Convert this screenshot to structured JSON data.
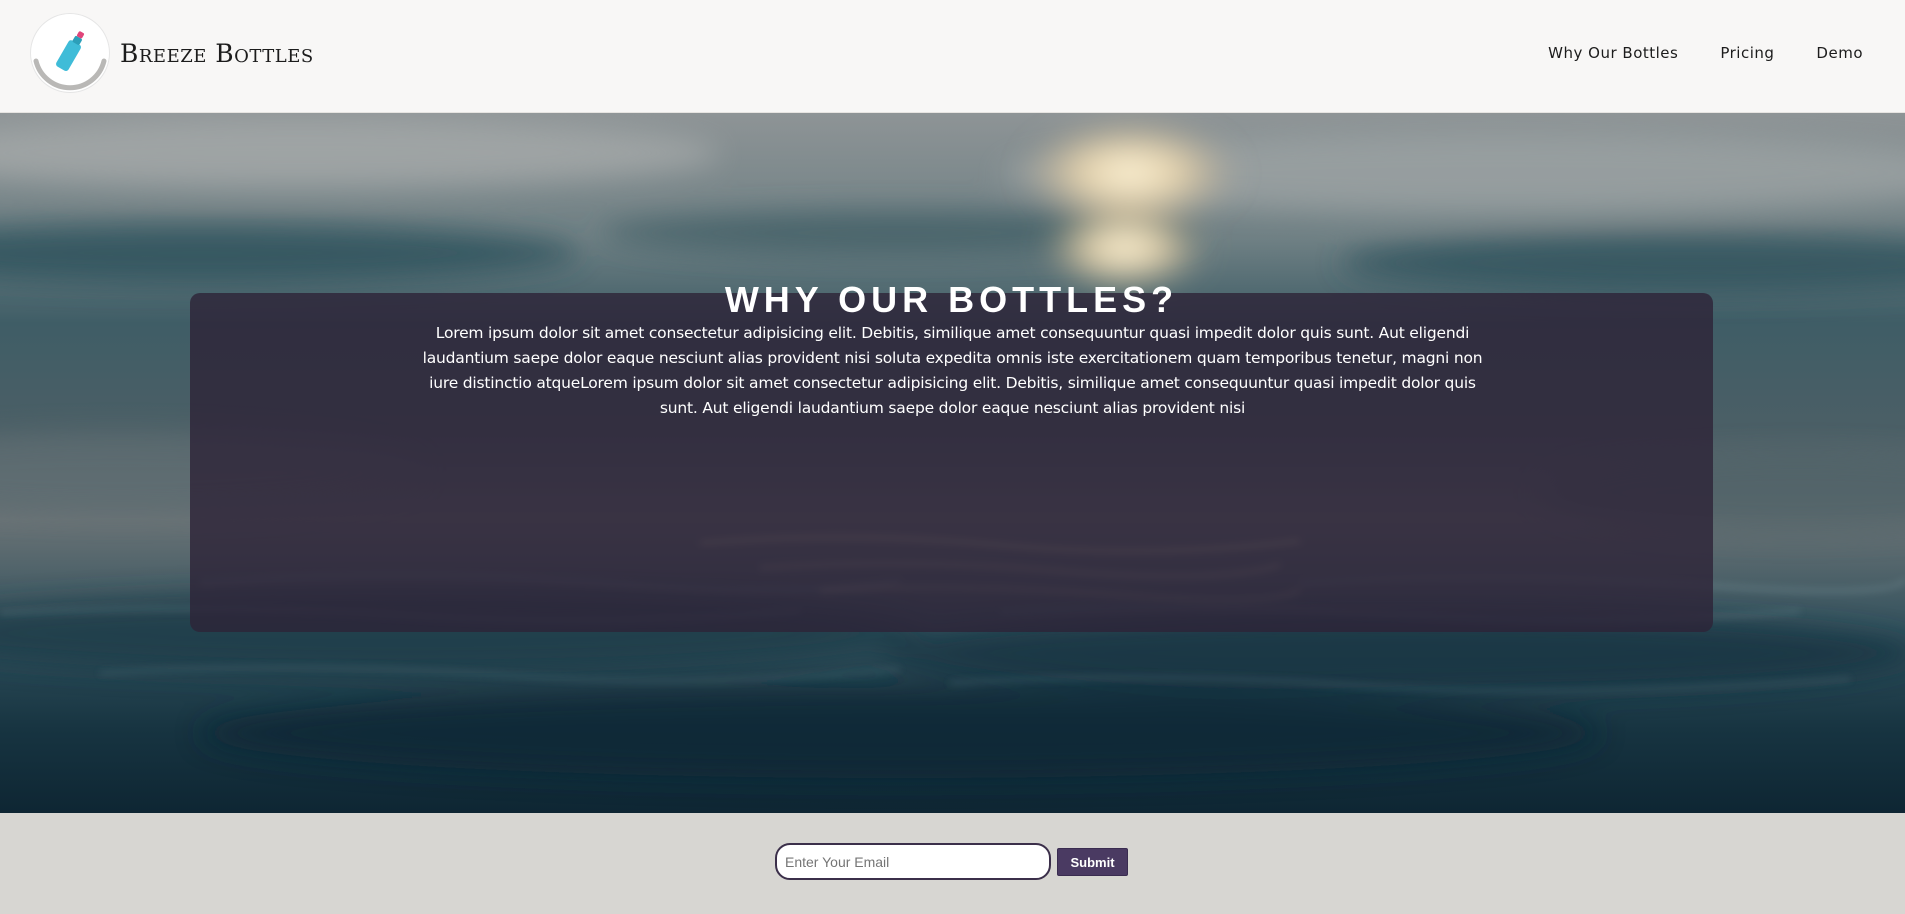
{
  "header": {
    "brand": "Breeze Bottles",
    "nav": [
      {
        "label": "Why Our Bottles"
      },
      {
        "label": "Pricing"
      },
      {
        "label": "Demo"
      }
    ]
  },
  "hero": {
    "title": "WHY OUR BOTTLES?",
    "body": "Lorem ipsum dolor sit amet consectetur adipisicing elit. Debitis, similique amet consequuntur quasi impedit dolor quis sunt. Aut eligendi laudantium saepe dolor eaque nesciunt alias provident nisi soluta expedita omnis iste exercitationem quam temporibus tenetur, magni non iure distinctio atqueLorem ipsum dolor sit amet consectetur adipisicing elit. Debitis, similique amet consequuntur quasi impedit dolor quis sunt. Aut eligendi laudantium saepe dolor eaque nesciunt alias provident nisi"
  },
  "signup": {
    "email_placeholder": "Enter Your Email",
    "submit_label": "Submit"
  },
  "colors": {
    "accent": "#4a3a62",
    "overlay": "#2d2337",
    "header_bg": "#f8f7f6",
    "footer_bg": "#d7d6d2",
    "logo_bottle": "#3fbcd8"
  },
  "icons": {
    "logo": "water-bottle-icon"
  }
}
